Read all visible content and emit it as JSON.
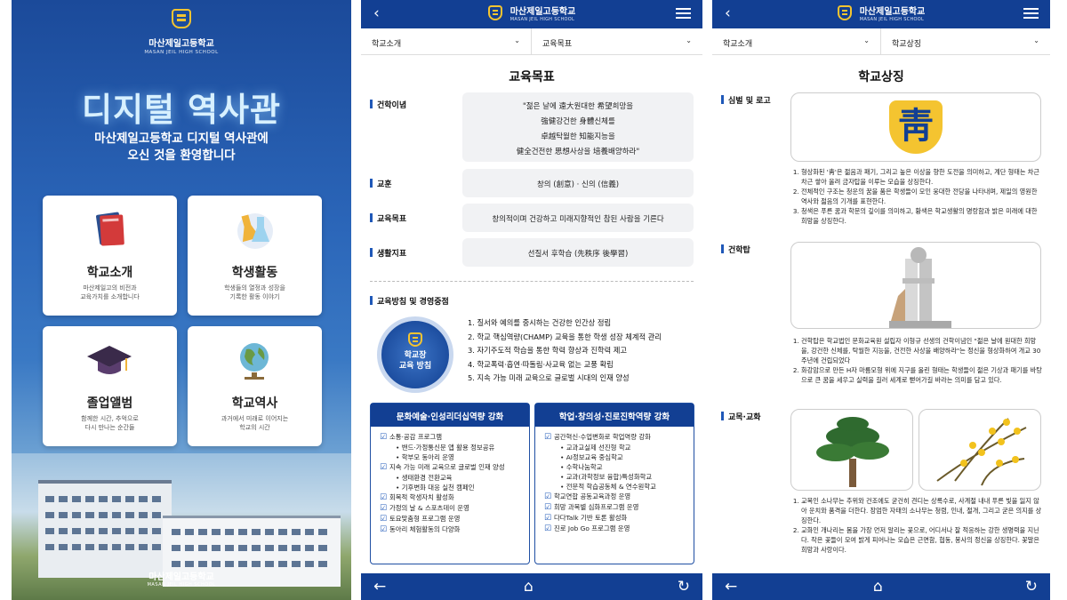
{
  "colors": {
    "brand_blue": "#123f93",
    "accent_blue": "#1f58b8",
    "crest_gold": "#f4c430"
  },
  "intro": {
    "school_name": "마산제일고등학교",
    "school_name_en": "MASAN JEIL HIGH SCHOOL",
    "title": "디지털 역사관",
    "welcome_line1": "마산제일고등학교 디지털 역사관에",
    "welcome_line2": "오신 것을 환영합니다",
    "cards": [
      {
        "title": "학교소개",
        "desc1": "마산제일고의 비전과",
        "desc2": "교육가치를 소개합니다",
        "icon": "book-icon"
      },
      {
        "title": "학생활동",
        "desc1": "학생들의 열정과 성장을",
        "desc2": "기록한 활동 이야기",
        "icon": "flask-icon"
      },
      {
        "title": "졸업앨범",
        "desc1": "함께한 시간, 추억으로",
        "desc2": "다시 만나는 순간들",
        "icon": "graduation-cap-icon"
      },
      {
        "title": "학교역사",
        "desc1": "과거에서 미래로 이어지는",
        "desc2": "학교의 시간",
        "icon": "globe-icon"
      }
    ],
    "footer_name": "마산제일고등학교",
    "footer_name_en": "MASAN JEIL HIGH SCHOOL"
  },
  "header": {
    "school_name": "마산제일고등학교",
    "school_name_en": "MASAN JEIL HIGH SCHOOL"
  },
  "goals_page": {
    "select_left": "학교소개",
    "select_right": "교육목표",
    "title": "교육목표",
    "sections": {
      "philosophy": "건학이념",
      "motto_label": "교훈",
      "goal_label": "교육목표",
      "life_label": "생활지표",
      "policy_label": "교육방침 및 경영중점"
    },
    "philosophy_lines": [
      "\"젊은 날에 遠大원대한 希望희망을",
      "強健강건한 身體신체를",
      "卓越탁월한 知能지능을",
      "健全건전한 思想사상을 培養배양하라\""
    ],
    "motto": "창의 (創意)  ·  신의 (信義)",
    "goal": "창의적이며 건강하고 미래지향적인 참된 사람을 기른다",
    "life": "선질서 후학습 (先秩序 後學習)",
    "policy_circle_line1": "학교장",
    "policy_circle_line2": "교육 방침",
    "policies": [
      "1. 질서와 예의를 중시하는 건강한 인간상 정립",
      "2. 학교 핵심역량(CHAMP) 교육을 통한 학생 성장 체계적 관리",
      "3. 자기주도적 학습을 통한 학력 향상과 진학력 제고",
      "4. 학교폭력·흡연·따돌림·사교육 없는 교풍 확립",
      "5. 지속 가능 미래 교육으로 글로벌 시대의 인재 양성"
    ],
    "box_left": {
      "title": "문화예술·인성리더십역량 강화",
      "items": [
        {
          "t": "소통·공감 프로그램",
          "sub": false
        },
        {
          "t": "밴드·가정통신문 앱 활용 정보공유",
          "sub": true
        },
        {
          "t": "학부모 동아리 운영",
          "sub": true
        },
        {
          "t": "지속 가능 미래 교육으로 글로벌 인재 양성",
          "sub": false
        },
        {
          "t": "생태환경 전환교육",
          "sub": true
        },
        {
          "t": "기후변화 대응 실천 캠페인",
          "sub": true
        },
        {
          "t": "회복적 학생자치 활성화",
          "sub": false
        },
        {
          "t": "가정의 날 & 스포츠데이 운영",
          "sub": false
        },
        {
          "t": "토요맞춤형 프로그램 운영",
          "sub": false
        },
        {
          "t": "동아리 체험활동의 다양화",
          "sub": false
        }
      ]
    },
    "box_right": {
      "title": "학업·창의성·진로진학역량 강화",
      "items": [
        {
          "t": "공간혁신·수업변화로 학업역량 강화",
          "sub": false
        },
        {
          "t": "교과교실제 선진형 학교",
          "sub": true
        },
        {
          "t": "AI정보교육 중심학교",
          "sub": true
        },
        {
          "t": "수학나눔학교",
          "sub": true
        },
        {
          "t": "교과(과학정보 융합)특성화학교",
          "sub": true
        },
        {
          "t": "전문적 학습공동체 & 연수원학교",
          "sub": true
        },
        {
          "t": "학교연합 공동교육과정 운영",
          "sub": false
        },
        {
          "t": "희망 과목별 심화프로그램 운영",
          "sub": false
        },
        {
          "t": "다다Talk 기반 토론 활성화",
          "sub": false
        },
        {
          "t": "진로 Job Go 프로그램 운영",
          "sub": false
        }
      ]
    }
  },
  "symbols_page": {
    "select_left": "학교소개",
    "select_right": "학교상징",
    "title": "학교상징",
    "emblem_label": "심벌 및 로고",
    "tower_label": "건학탑",
    "tree_label": "교목·교화",
    "emblem_char": "靑",
    "emblem_notes": [
      "형상화된 '靑'은 젊음과 패기, 그리고 높은 이상을 향한 도전을 의미하고, 계단 형태는 차근차근 쌓아 올려 금자탑을 이루는 모습을 상징한다.",
      "전체적인 구조는 청운의 꿈을 품은 학생들이 모인 웅대한 전당을 나타내며, 제일의 영원한 역사와 젊음의 기개를 표현한다.",
      "청색은 푸른 꿈과 학문의 깊이를 의미하고, 황색은 학교생활의 명랑함과 밝은 미래에 대한 희망을 상징한다."
    ],
    "tower_notes": [
      "건학탑은 학교법인 문화교육원 설립자 이형규 선생의 건학이념인 \"젊은 날에 원대한 희망을, 강건한 신체를, 탁월한 지능을, 건전한 사상을 배양하라\"는 정신을 형상화하여 개교 30주년에 건립되었다",
      "화강암으로 만든 H자 마름모형 위에 지구를 올린 형태는 학생들이 젊은 기상과 패기를 바탕으로 큰 꿈을 세우고 실력을 길러 세계로 뻗어가길 바라는 의미를 담고 있다."
    ],
    "tree_notes": [
      "교목인 소나무는 추위와 건조에도 굳건히 견디는 상록수로, 사계절 내내 푸른 빛을 잃지 않아 운치와 품격을 더한다. 장엄한 자태의 소나무는 청렴, 인내, 절개, 그리고 굳은 의지를 상징한다.",
      "교화인 개나리는 봄을 가장 먼저 알리는 꽃으로, 어디서나 잘 적응하는 강한 생명력을 지닌다. 작은 꽃들이 모여 밝게 피어나는 모습은 근면함, 협동, 봉사의 정신을 상징한다. 꽃말은 희망과 사랑이다."
    ]
  },
  "nav": {
    "back_icon": "←",
    "home_icon": "⌂",
    "refresh_icon": "↻",
    "header_back": "‹",
    "chevron": "⌄"
  }
}
